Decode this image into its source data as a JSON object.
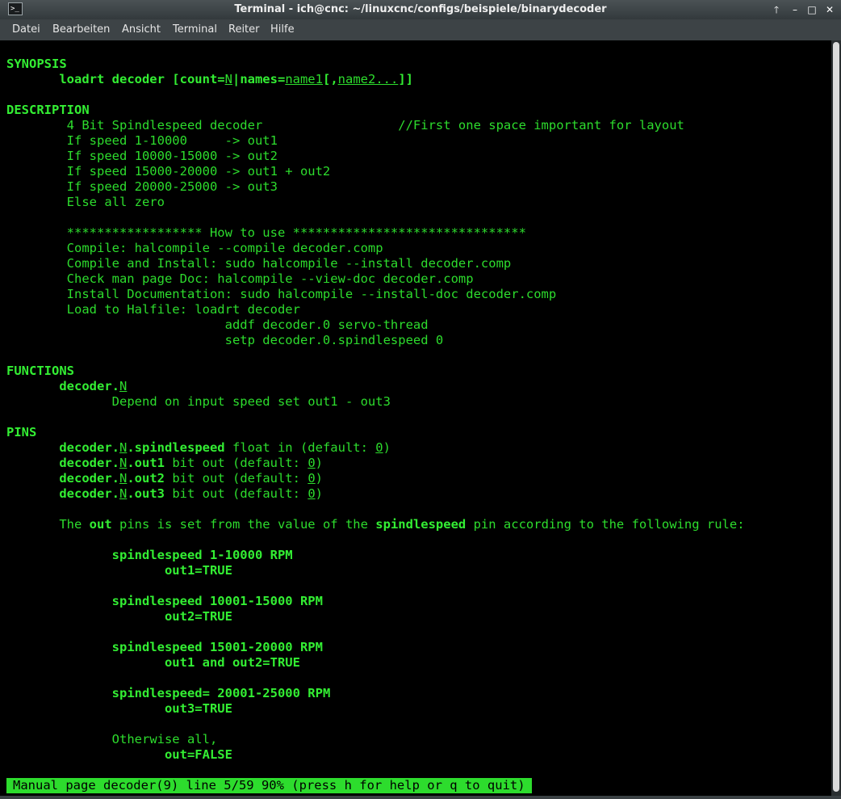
{
  "window": {
    "title": "Terminal - ich@cnc: ~/linuxcnc/configs/beispiele/binarydecoder",
    "app_icon_glyph": ">_",
    "buttons": {
      "up": "🡑",
      "minimize": "–",
      "maximize": "□",
      "close": "✕"
    }
  },
  "menu": [
    "Datei",
    "Bearbeiten",
    "Ansicht",
    "Terminal",
    "Reiter",
    "Hilfe"
  ],
  "man": {
    "synopsis_heading": "SYNOPSIS",
    "synopsis": {
      "cmd": "loadrt decoder [count=",
      "n": "N",
      "mid": "|names=",
      "name1": "name1",
      "comma": "[,",
      "name2": "name2...",
      "end": "]]"
    },
    "description_heading": "DESCRIPTION",
    "description": [
      "4 Bit Spindlespeed decoder                  //First one space important for layout",
      "If speed 1-10000     -> out1",
      "If speed 10000-15000 -> out2",
      "If speed 15000-20000 -> out1 + out2",
      "If speed 20000-25000 -> out3",
      "Else all zero",
      "****************** How to use *******************************",
      "Compile: halcompile --compile decoder.comp",
      "Compile and Install: sudo halcompile --install decoder.comp",
      "Check man page Doc: halcompile --view-doc decoder.comp",
      "Install Documentation: sudo halcompile --install-doc decoder.comp",
      "Load to Halfile: loadrt decoder",
      "                     addf decoder.0 servo-thread",
      "                     setp decoder.0.spindlespeed 0"
    ],
    "functions_heading": "FUNCTIONS",
    "function": {
      "prefix": "decoder.",
      "n": "N",
      "desc": "Depend on input speed set out1 - out3"
    },
    "pins_heading": "PINS",
    "pins": [
      {
        "prefix": "decoder.",
        "n": "N",
        "name": ".spindlespeed",
        "type": " float in (default: ",
        "def": "0",
        "close": ")"
      },
      {
        "prefix": "decoder.",
        "n": "N",
        "name": ".out1",
        "type": " bit out (default: ",
        "def": "0",
        "close": ")"
      },
      {
        "prefix": "decoder.",
        "n": "N",
        "name": ".out2",
        "type": " bit out (default: ",
        "def": "0",
        "close": ")"
      },
      {
        "prefix": "decoder.",
        "n": "N",
        "name": ".out3",
        "type": " bit out (default: ",
        "def": "0",
        "close": ")"
      }
    ],
    "rule": {
      "t1": "The ",
      "b1": "out",
      "t2": " pins is set from the value of the ",
      "b2": "spindlespeed",
      "t3": " pin according to the following rule:"
    },
    "rules": [
      {
        "cond": "spindlespeed 1-10000 RPM",
        "result": "out1=TRUE"
      },
      {
        "cond": "spindlespeed 10001-15000 RPM",
        "result": "out2=TRUE"
      },
      {
        "cond": "spindlespeed 15001-20000 RPM",
        "result": "out1 and out2=TRUE"
      },
      {
        "cond": "spindlespeed= 20001-25000 RPM",
        "result": "out3=TRUE"
      }
    ],
    "otherwise": "Otherwise all,",
    "otherwise_result": "out=FALSE"
  },
  "status": "Manual page decoder(9) line 5/59 90% (press h for help or q to quit)"
}
